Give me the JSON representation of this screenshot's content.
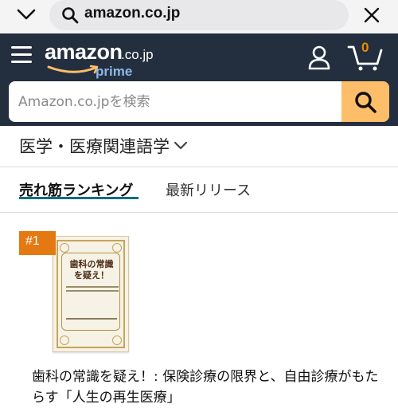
{
  "browser": {
    "url": "amazon.co.jp",
    "icons": {
      "left": "chevron-down-icon",
      "search": "search-icon",
      "right": "close-icon"
    }
  },
  "header": {
    "logo": {
      "brand": "amazon",
      "tld": ".co.jp",
      "program": "prime"
    },
    "cart_count": "0",
    "search_placeholder": "Amazon.co.jpを検索",
    "colors": {
      "header_bg": "#232f3e",
      "search_button": "#febd69",
      "accent": "#f08804"
    }
  },
  "category": {
    "label": "医学・医療関連語学"
  },
  "tabs": [
    {
      "label": "売れ筋ランキング",
      "active": true
    },
    {
      "label": "最新リリース",
      "active": false
    }
  ],
  "product": {
    "rank": "#1",
    "cover_title_lines": [
      "歯科の常識",
      "を疑え！"
    ],
    "title": "歯科の常識を疑え！: 保険診療の限界と、自由診療がもたらす「人生の再生医療」"
  }
}
